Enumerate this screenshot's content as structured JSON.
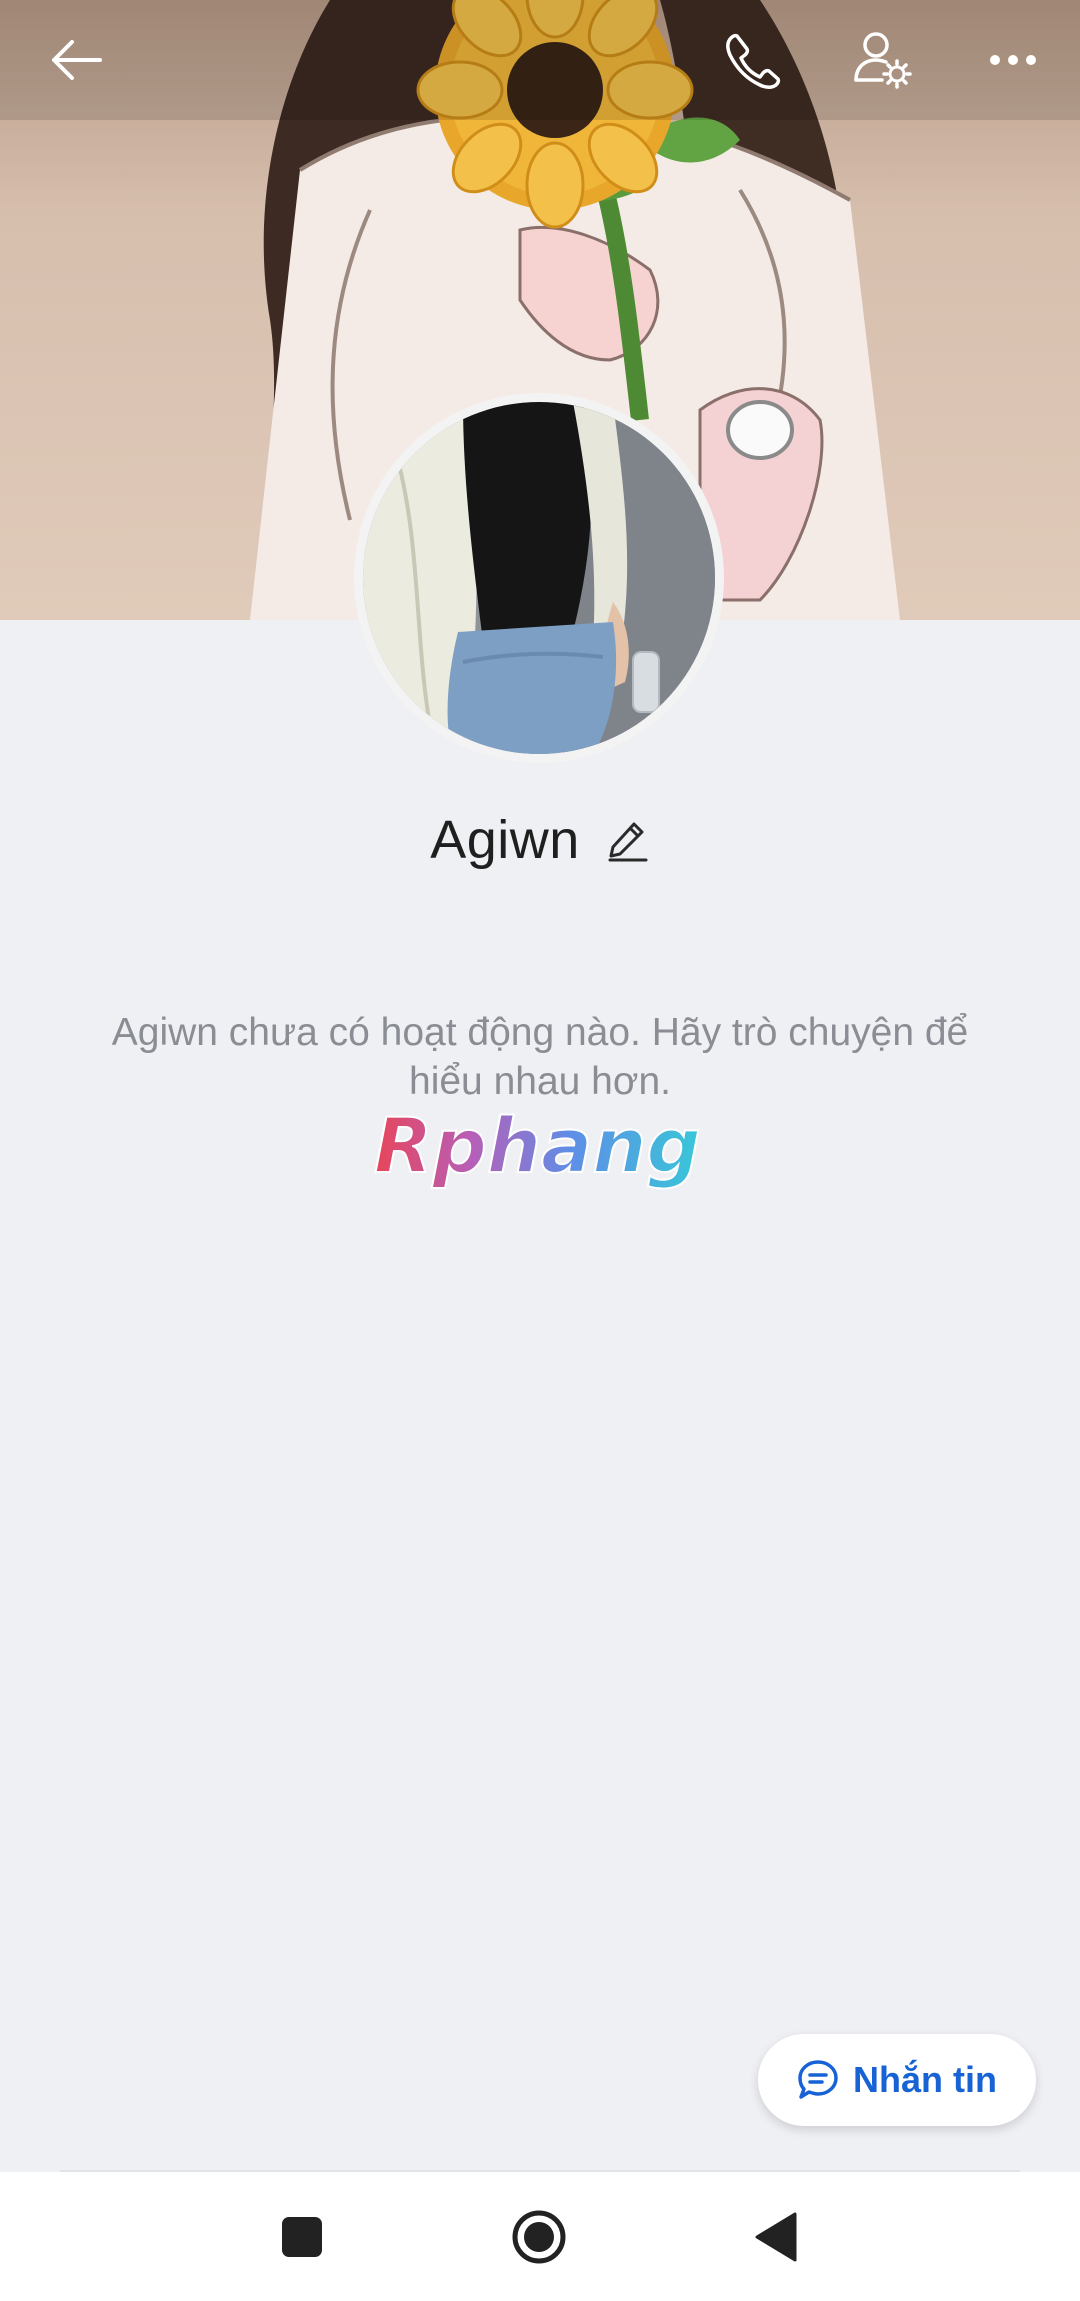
{
  "profile": {
    "name": "Agiwn",
    "empty_activity_message": "Agiwn chưa có hoạt động nào. Hãy trò chuyện để hiểu nhau hơn."
  },
  "watermark": {
    "text": "Rphang"
  },
  "actions": {
    "message_label": "Nhắn tin"
  },
  "icons": {
    "back": "arrow-left-icon",
    "call": "phone-icon",
    "profile_settings": "user-settings-icon",
    "more": "more-horizontal-icon",
    "edit": "pencil-icon",
    "message": "chat-bubble-icon",
    "nav_recents": "square-icon",
    "nav_home": "circle-icon",
    "nav_back": "triangle-back-icon"
  },
  "colors": {
    "background": "#eff0f4",
    "accent": "#1763d6",
    "text_primary": "#1f1f1f",
    "text_secondary": "#8a8d93"
  }
}
